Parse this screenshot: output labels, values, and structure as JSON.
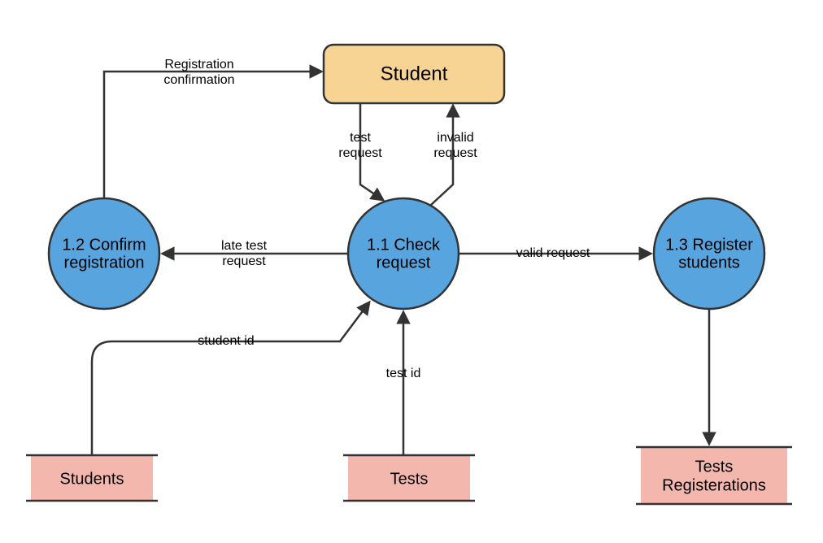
{
  "diagram": {
    "entity": {
      "label": "Student"
    },
    "processes": {
      "p11": {
        "line1": "1.1 Check",
        "line2": "request"
      },
      "p12": {
        "line1": "1.2 Confirm",
        "line2": "registration"
      },
      "p13": {
        "line1": "1.3 Register",
        "line2": "students"
      }
    },
    "stores": {
      "students": {
        "label": "Students"
      },
      "tests": {
        "label": "Tests"
      },
      "registrations": {
        "line1": "Tests",
        "line2": "Registerations"
      }
    },
    "flows": {
      "reg_confirm": {
        "line1": "Registration",
        "line2": "confirmation"
      },
      "test_request": {
        "line1": "test",
        "line2": "request"
      },
      "invalid_request": {
        "line1": "invalid",
        "line2": "request"
      },
      "late_test": {
        "line1": "late test",
        "line2": "request"
      },
      "valid_request": {
        "label": "valid request"
      },
      "student_id": {
        "label": "student id"
      },
      "test_id": {
        "label": "test id"
      }
    }
  }
}
